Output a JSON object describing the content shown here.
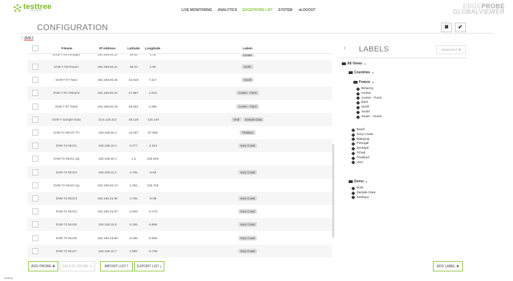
{
  "header": {
    "logo_text": "testtree",
    "logo_sub": "GROUPE",
    "nav": [
      {
        "label": "LIVE MONITORING"
      },
      {
        "label": "ANALYTICS"
      },
      {
        "label": "EDGEPROBE LIST"
      },
      {
        "label": "SYSTEM"
      },
      {
        "label": "LOGOUT"
      }
    ],
    "active_nav": "EDGEPROBE LIST",
    "brand_line1_light": "EDGE",
    "brand_line1_dark": "PROBE",
    "brand_line2": "GLOBALVIEWER"
  },
  "page": {
    "title": "CONFIGURATION",
    "close_label": "✖",
    "confirm_label": "✔"
  },
  "search": {
    "value": "dvb-t",
    "icon": "search-icon"
  },
  "table": {
    "columns": [
      "▼Name",
      "IP Address",
      "Latitude",
      "Longitude",
      "Labels"
    ],
    "partial_row": {
      "name": "DVB-T R6 Limoges",
      "ip": "192.168.80.14",
      "lat": "45.83",
      "lon": "1.26",
      "labels": [
        "Center"
      ]
    },
    "rows": [
      {
        "name": "DVB-T R6 Rouen",
        "ip": "192.168.80.21",
        "lat": "49.44",
        "lon": "1.05",
        "labels": [
          "North"
        ]
      },
      {
        "name": "DVB-T R7 Nice",
        "ip": "192.168.80.25",
        "lat": "43.819",
        "lon": "7.317",
        "labels": [
          "South"
        ]
      },
      {
        "name": "DVB-T R7 Orleans",
        "ip": "192.168.80.22",
        "lat": "47.887",
        "lon": "1.978",
        "labels": [
          "Center - Paris"
        ]
      },
      {
        "name": "DVB-T R7 Paris",
        "ip": "192.168.80.16",
        "lat": "48.821",
        "lon": "2.285",
        "labels": [
          "Center - Paris"
        ]
      },
      {
        "name": "DVB-T Sample Data",
        "ip": "10.5.129.212",
        "lat": "36.128",
        "lon": "-115.149",
        "labels": [
          "NAB",
          "Sample Data"
        ]
      },
      {
        "name": "DVB-T2 MCOT Th",
        "ip": "192.168.90.2",
        "lat": "19.297",
        "lon": "97.958",
        "labels": [
          "Thailand"
        ]
      },
      {
        "name": "DVB-T2 MUX1",
        "ip": "192.168.15.1",
        "lat": "5.277",
        "lon": "-4.021",
        "labels": [
          "Ivory Coast"
        ]
      },
      {
        "name": "DVB-T2 MUX1 Sg",
        "ip": "192.168.60.1",
        "lat": "1.3",
        "lon": "103.845",
        "labels": []
      },
      {
        "name": "DVB-T2 MUX2",
        "ip": "192.168.15.2",
        "lat": "4.795",
        "lon": "-6.68",
        "labels": [
          "Ivory Coast"
        ]
      },
      {
        "name": "DVB-T2 MUX2 Sg",
        "ip": "192.168.60.10",
        "lat": "1.354",
        "lon": "103.749",
        "labels": []
      },
      {
        "name": "DVB-T2 MUX3",
        "ip": "192.168.15.96",
        "lat": "4.795",
        "lon": "-6.68",
        "labels": [
          "Ivory Coast"
        ]
      },
      {
        "name": "DVB-T2 MUX4",
        "ip": "192.168.15.97",
        "lat": "6.926",
        "lon": "-5.175",
        "labels": [
          "Ivory Coast"
        ]
      },
      {
        "name": "DVB-T2 MUX5",
        "ip": "192.168.15.5",
        "lat": "6.195",
        "lon": "-5.966",
        "labels": [
          "Ivory Coast"
        ]
      },
      {
        "name": "DVB-T2 MUX6",
        "ip": "192.168.15.99",
        "lat": "6.195",
        "lon": "-5.966",
        "labels": [
          "Ivory Coast"
        ]
      },
      {
        "name": "DVB-T2 MUX7",
        "ip": "192.168.15.7",
        "lat": "4.982",
        "lon": "-5.736",
        "labels": [
          "Ivory Coast"
        ]
      }
    ]
  },
  "buttons": {
    "add_probe": "ADD PROBE ✚",
    "delete_probe": "DELETE PROBE ⊝",
    "import_list": "IMPORT LIST ⤒",
    "export_list": "EXPORT LIST ⤓",
    "add_label": "ADD LABEL ✚"
  },
  "labels_panel": {
    "back": "‹",
    "title": "LABELS",
    "unselect": "UNSELECT ✖",
    "all_views": "All Views",
    "countries": "Countries",
    "france": "France",
    "france_items": [
      "Britanny",
      "Center",
      "Center - Paris",
      "East",
      "North",
      "South",
      "South - Ouest"
    ],
    "country_items": [
      "Brazil",
      "Ivory Coast",
      "Malaysia",
      "Portugal",
      "Senegal",
      "Tchad",
      "Thailand",
      "USA"
    ],
    "demo": "Demo",
    "demo_items": [
      "NAB",
      "Sample Data",
      "SetExpo"
    ]
  },
  "status": {
    "activity": "Activity"
  }
}
